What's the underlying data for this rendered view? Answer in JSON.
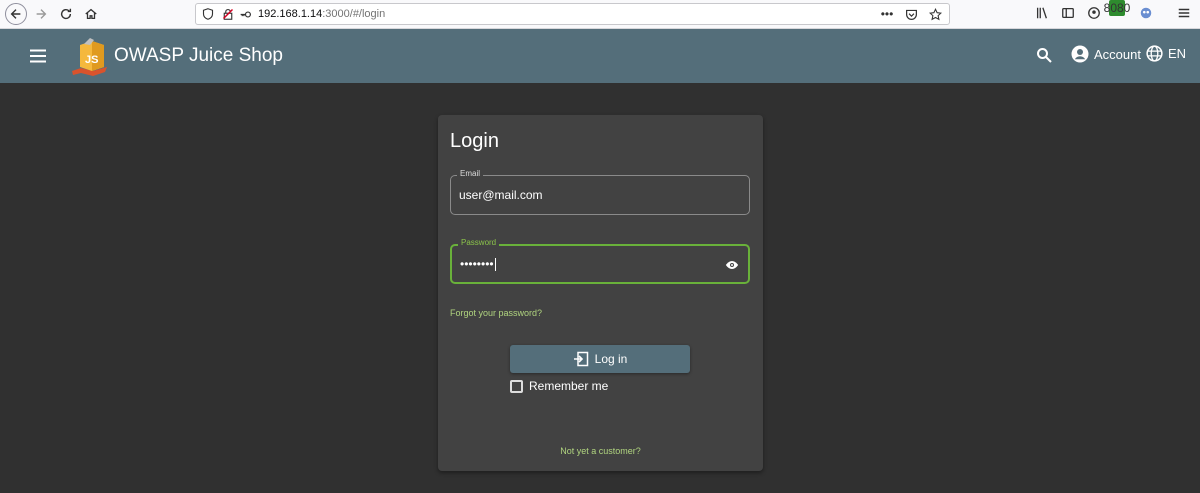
{
  "browser": {
    "url_host": "192.168.1.14",
    "url_path": ":3000/#/login",
    "more_label": "•••",
    "proxy_badge": "8080"
  },
  "toolbar": {
    "app_title": "OWASP Juice Shop",
    "account_label": "Account",
    "language_label": "EN",
    "logo_text": "JS"
  },
  "login": {
    "title": "Login",
    "email_label": "Email",
    "email_value": "user@mail.com",
    "password_label": "Password",
    "password_value": "••••••••",
    "forgot_link": "Forgot your password?",
    "login_button": "Log in",
    "remember_label": "Remember me",
    "not_customer_link": "Not yet a customer?"
  },
  "colors": {
    "toolbar_bg": "#546e7a",
    "background": "#303030",
    "card_bg": "#424242",
    "accent_green": "#8bc34a"
  }
}
